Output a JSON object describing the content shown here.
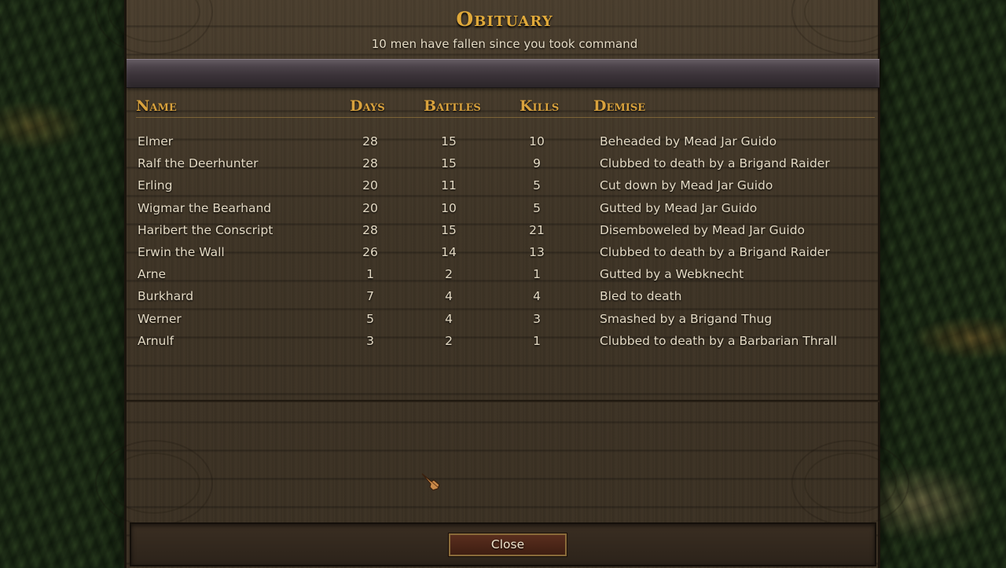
{
  "dialog": {
    "title": "Obituary",
    "subtitle": "10 men have fallen since you took command",
    "close_label": "Close"
  },
  "columns": {
    "name": "Name",
    "days": "Days",
    "battles": "Battles",
    "kills": "Kills",
    "demise": "Demise"
  },
  "rows": [
    {
      "name": "Elmer",
      "days": "28",
      "battles": "15",
      "kills": "10",
      "demise": "Beheaded by Mead Jar Guido"
    },
    {
      "name": "Ralf the Deerhunter",
      "days": "28",
      "battles": "15",
      "kills": "9",
      "demise": "Clubbed to death by a Brigand Raider"
    },
    {
      "name": "Erling",
      "days": "20",
      "battles": "11",
      "kills": "5",
      "demise": "Cut down by Mead Jar Guido"
    },
    {
      "name": "Wigmar the Bearhand",
      "days": "20",
      "battles": "10",
      "kills": "5",
      "demise": "Gutted by Mead Jar Guido"
    },
    {
      "name": "Haribert the Conscript",
      "days": "28",
      "battles": "15",
      "kills": "21",
      "demise": "Disemboweled by Mead Jar Guido"
    },
    {
      "name": "Erwin the Wall",
      "days": "26",
      "battles": "14",
      "kills": "13",
      "demise": "Clubbed to death by a Brigand Raider"
    },
    {
      "name": "Arne",
      "days": "1",
      "battles": "2",
      "kills": "1",
      "demise": "Gutted by a Webknecht"
    },
    {
      "name": "Burkhard",
      "days": "7",
      "battles": "4",
      "kills": "4",
      "demise": "Bled to death"
    },
    {
      "name": "Werner",
      "days": "5",
      "battles": "4",
      "kills": "3",
      "demise": "Smashed by a Brigand Thug"
    },
    {
      "name": "Arnulf",
      "days": "3",
      "battles": "2",
      "kills": "1",
      "demise": "Clubbed to death by a Barbarian Thrall"
    }
  ],
  "colors": {
    "title": "#e0a93a",
    "header": "#d9a23d",
    "text": "#e4dac4",
    "button": "#5a2e1e"
  },
  "icons": {
    "cursor": "gauntlet-cursor-icon"
  }
}
